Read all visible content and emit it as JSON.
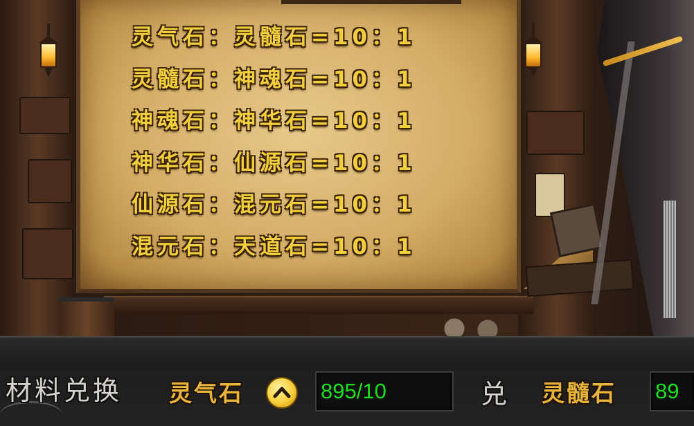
{
  "rules": [
    "灵气石：灵髓石=10：1",
    "灵髓石：神魂石=10：1",
    "神魂石：神华石=10：1",
    "神华石：仙源石=10：1",
    "仙源石：混元石=10：1",
    "混元石：天道石=10：1"
  ],
  "exchange": {
    "title": "材料兑换",
    "source_material": "灵气石",
    "source_count": "895/10",
    "action_label": "兑",
    "target_material": "灵髓石",
    "target_count": "89"
  },
  "colors": {
    "rule_text": "#f2cf3c",
    "material_text": "#e8b43c",
    "count_text": "#18e01c",
    "arrow_button": "#f7cf36"
  },
  "icons": {
    "arrow_button": "chevron-up-icon",
    "lanterns": "lantern-icon"
  }
}
